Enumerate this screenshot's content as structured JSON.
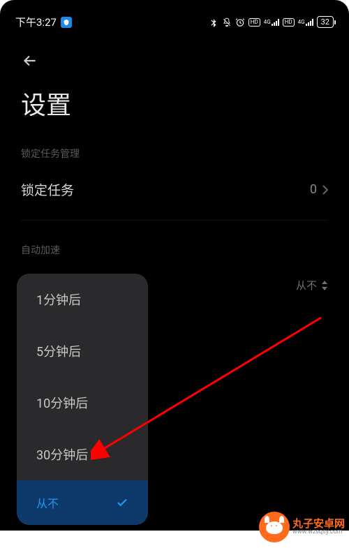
{
  "statusBar": {
    "time": "下午3:27",
    "hdBadge": "HD",
    "signalLabel": "4G",
    "battery": "32"
  },
  "page": {
    "title": "设置"
  },
  "sections": {
    "lockTask": {
      "header": "锁定任务管理",
      "label": "锁定任务",
      "value": "0"
    },
    "autoSpeed": {
      "header": "自动加速",
      "triggerLabel": "从不"
    }
  },
  "popup": {
    "options": [
      {
        "label": "1分钟后"
      },
      {
        "label": "5分钟后"
      },
      {
        "label": "10分钟后"
      },
      {
        "label": "30分钟后"
      }
    ],
    "selected": "从不"
  },
  "watermark": {
    "name": "丸子安卓网",
    "url": "www.wzsqsy.com"
  },
  "colors": {
    "accent": "#2196f3",
    "annotation": "#ff0000",
    "brand": "#ff6b1a"
  }
}
